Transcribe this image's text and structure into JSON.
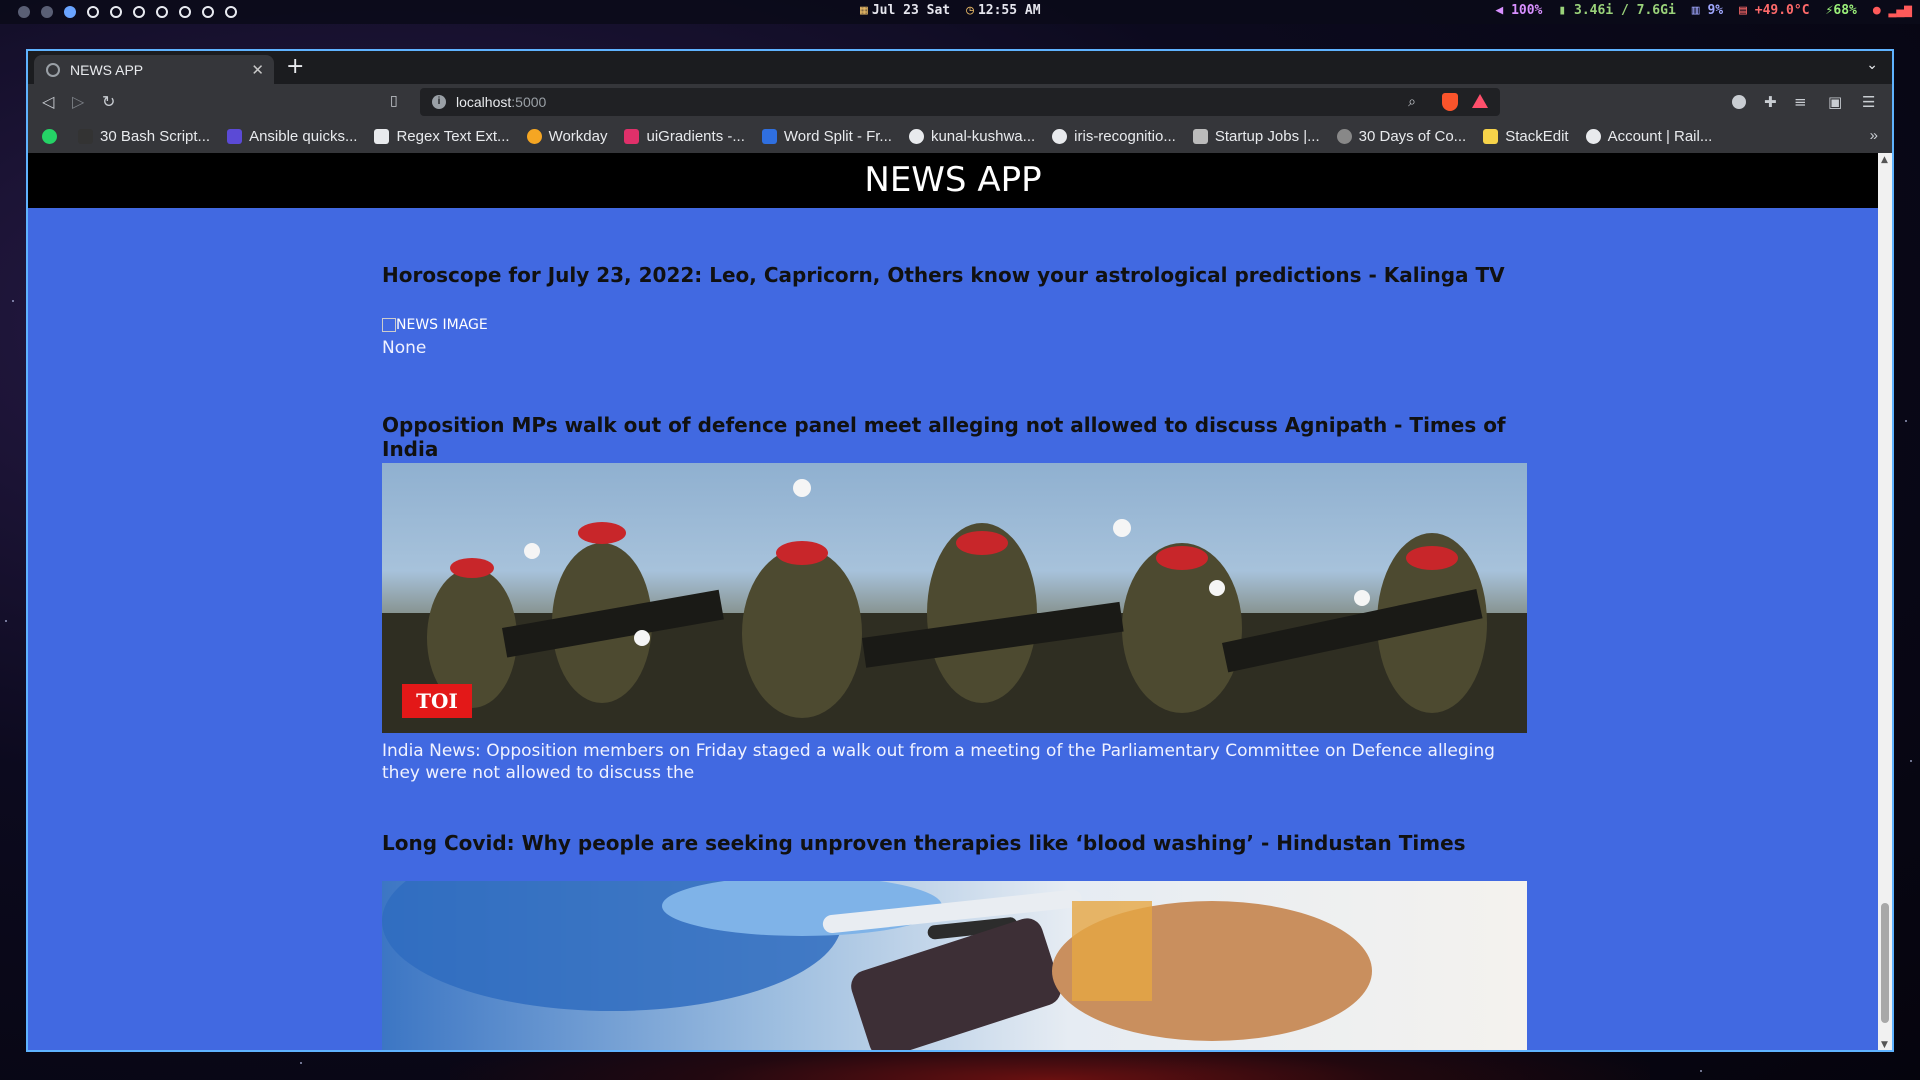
{
  "system_bar": {
    "date": "Jul 23 Sat",
    "time": "12:55 AM",
    "volume": "100%",
    "memory": "3.46i / 7.6Gi",
    "cpu": "9%",
    "temperature": "+49.0°C",
    "battery": "68%"
  },
  "browser": {
    "tab_title": "NEWS APP",
    "url_host": "localhost",
    "url_port": ":5000",
    "bookmarks": [
      {
        "label": "30 Bash Script...",
        "icon": "terminal-icon",
        "color": "#333333"
      },
      {
        "label": "Ansible quicks...",
        "icon": "ansible-icon",
        "color": "#5b4ad6"
      },
      {
        "label": "Regex Text Ext...",
        "icon": "doc-icon",
        "color": "#e8eaed"
      },
      {
        "label": "Workday",
        "icon": "workday-icon",
        "color": "#f5a623"
      },
      {
        "label": "uiGradients -...",
        "icon": "gradient-icon",
        "color": "#e0306a"
      },
      {
        "label": "Word Split - Fr...",
        "icon": "s-icon",
        "color": "#2f6fe0"
      },
      {
        "label": "kunal-kushwa...",
        "icon": "github-icon",
        "color": "#e8eaed"
      },
      {
        "label": "iris-recognitio...",
        "icon": "github-icon",
        "color": "#e8eaed"
      },
      {
        "label": "Startup Jobs |...",
        "icon": "hand-icon",
        "color": "#e8eaed"
      },
      {
        "label": "30 Days of Co...",
        "icon": "globe-icon",
        "color": "#888888"
      },
      {
        "label": "StackEdit",
        "icon": "stackedit-icon",
        "color": "#f6d34a"
      },
      {
        "label": "Account | Rail...",
        "icon": "rail-icon",
        "color": "#e8eaed"
      }
    ]
  },
  "page": {
    "header": "NEWS APP",
    "articles": [
      {
        "title": "Horoscope for July 23, 2022: Leo, Capricorn, Others know your astrological predictions - Kalinga TV",
        "image_alt": "NEWS IMAGE",
        "description": "None"
      },
      {
        "title": "Opposition MPs walk out of defence panel meet alleging not allowed to discuss Agnipath - Times of India",
        "image_badge": "TOI",
        "description": "India News: Opposition members on Friday staged a walk out from a meeting of the Parliamentary Committee on Defence alleging they were not allowed to discuss the"
      },
      {
        "title": "Long Covid: Why people are seeking unproven therapies like ‘blood washing’ - Hindustan Times"
      }
    ]
  },
  "colors": {
    "page_bg": "#4169e1",
    "header_bg": "#000000",
    "window_border": "#5fb3ff"
  }
}
